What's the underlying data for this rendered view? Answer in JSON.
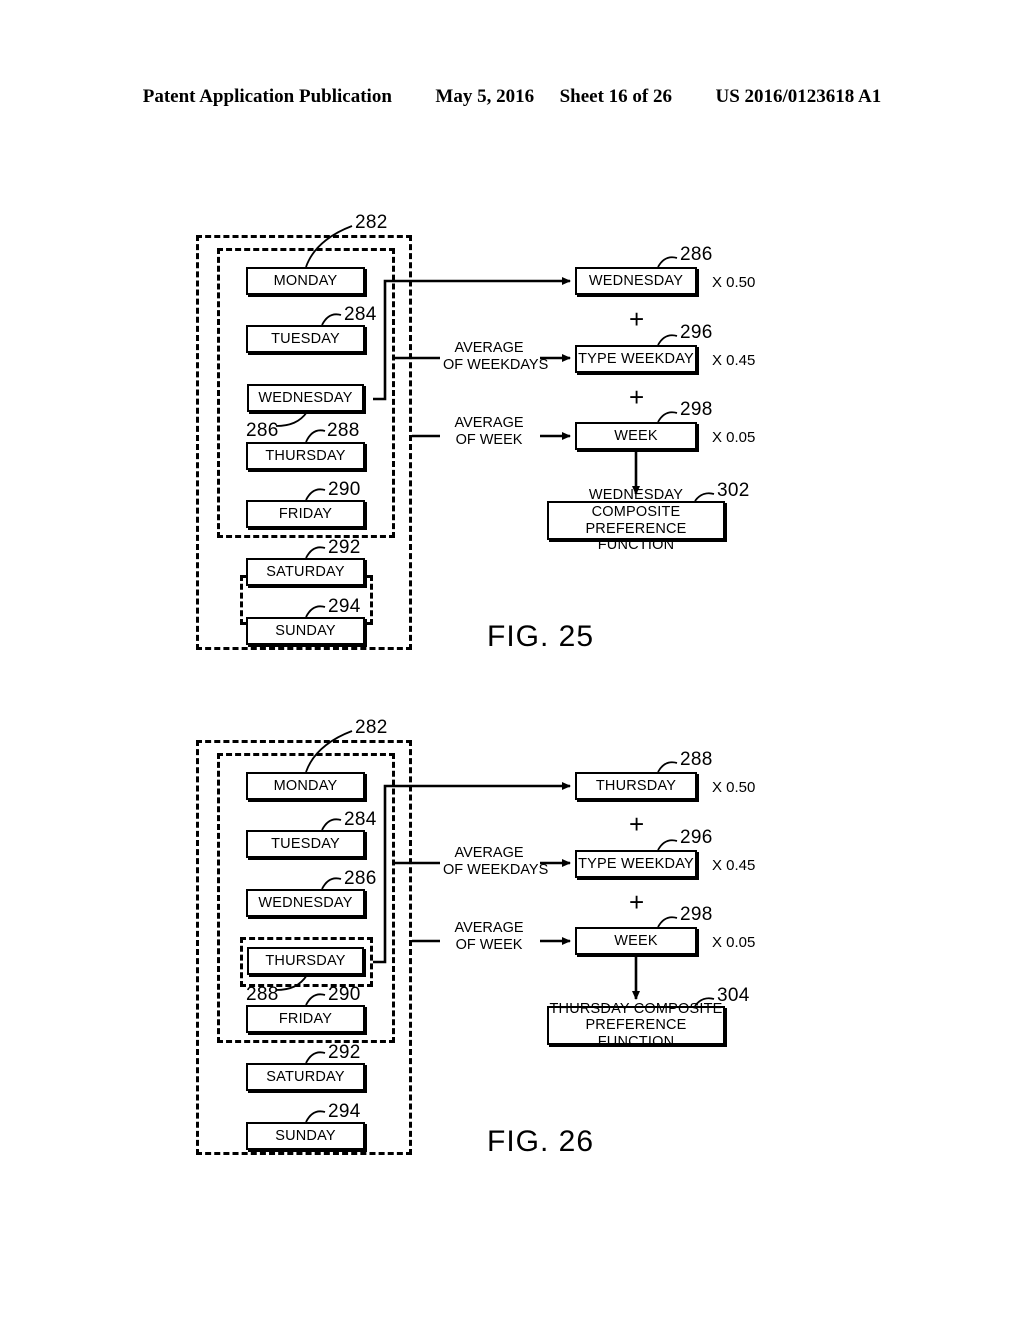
{
  "header": {
    "publication": "Patent Application Publication",
    "date": "May 5, 2016",
    "sheet": "Sheet 16 of 26",
    "patent_number": "US 2016/0123618 A1"
  },
  "figures": [
    {
      "id": "figure-25",
      "label": "FIG. 25",
      "selected_day": "WEDNESDAY",
      "days": [
        {
          "label": "MONDAY",
          "ref": "282"
        },
        {
          "label": "TUESDAY",
          "ref": "284"
        },
        {
          "label": "WEDNESDAY",
          "ref": "286"
        },
        {
          "label": "THURSDAY",
          "ref": "288"
        },
        {
          "label": "FRIDAY",
          "ref": "290"
        },
        {
          "label": "SATURDAY",
          "ref": "292"
        },
        {
          "label": "SUNDAY",
          "ref": "294"
        }
      ],
      "connectors": [
        {
          "line1": "AVERAGE",
          "line2": "OF WEEKDAYS"
        },
        {
          "line1": "AVERAGE",
          "line2": "OF WEEK"
        }
      ],
      "terms": [
        {
          "label": "WEDNESDAY",
          "ref": "286",
          "weight": "X 0.50"
        },
        {
          "label": "TYPE WEEKDAY",
          "ref": "296",
          "weight": "X 0.45"
        },
        {
          "label": "WEEK",
          "ref": "298",
          "weight": "X 0.05"
        }
      ],
      "operators": [
        "+",
        "+"
      ],
      "result": {
        "line1": "WEDNESDAY COMPOSITE",
        "line2": "PREFERENCE FUNCTION",
        "ref": "302"
      }
    },
    {
      "id": "figure-26",
      "label": "FIG. 26",
      "selected_day": "THURSDAY",
      "days": [
        {
          "label": "MONDAY",
          "ref": "282"
        },
        {
          "label": "TUESDAY",
          "ref": "284"
        },
        {
          "label": "WEDNESDAY",
          "ref": "286"
        },
        {
          "label": "THURSDAY",
          "ref": "288"
        },
        {
          "label": "FRIDAY",
          "ref": "290"
        },
        {
          "label": "SATURDAY",
          "ref": "292"
        },
        {
          "label": "SUNDAY",
          "ref": "294"
        }
      ],
      "connectors": [
        {
          "line1": "AVERAGE",
          "line2": "OF WEEKDAYS"
        },
        {
          "line1": "AVERAGE",
          "line2": "OF WEEK"
        }
      ],
      "terms": [
        {
          "label": "THURSDAY",
          "ref": "288",
          "weight": "X 0.50"
        },
        {
          "label": "TYPE WEEKDAY",
          "ref": "296",
          "weight": "X 0.45"
        },
        {
          "label": "WEEK",
          "ref": "298",
          "weight": "X 0.05"
        }
      ],
      "operators": [
        "+",
        "+"
      ],
      "result": {
        "line1": "THURSDAY COMPOSITE",
        "line2": "PREFERENCE FUNCTION",
        "ref": "304"
      }
    }
  ]
}
